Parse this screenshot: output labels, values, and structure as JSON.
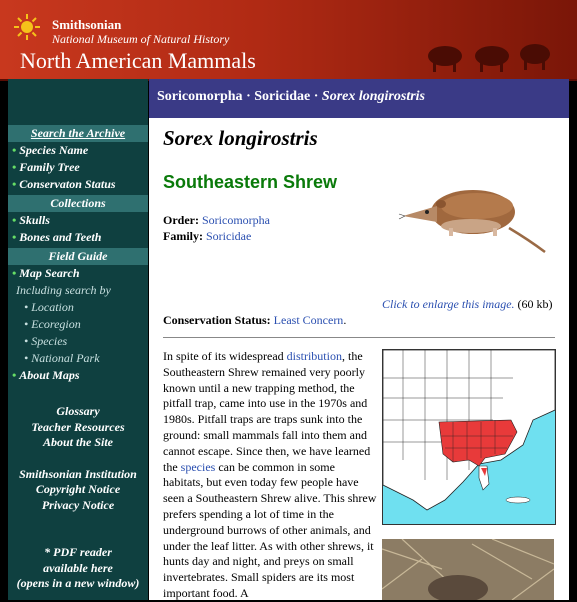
{
  "header": {
    "institution": "Smithsonian",
    "museum": "National Museum of Natural History",
    "site_title": "North American Mammals"
  },
  "sidebar": {
    "archive_heading": "Search the Archive",
    "archive_items": [
      "Species Name",
      "Family Tree",
      "Conservaton Status"
    ],
    "collections_heading": "Collections",
    "collections_items": [
      "Skulls",
      "Bones and Teeth"
    ],
    "field_guide_heading": "Field Guide",
    "map_search": "Map Search",
    "including": "Including search by",
    "search_by": [
      "Location",
      "Ecoregion",
      "Species",
      "National Park"
    ],
    "about_maps": "About Maps",
    "links1": [
      "Glossary",
      "Teacher Resources",
      "About the Site"
    ],
    "links2": [
      "Smithsonian Institution",
      "Copyright Notice",
      "Privacy Notice"
    ],
    "pdf_note": [
      "* PDF reader",
      "available here",
      "(opens in a new window)"
    ]
  },
  "breadcrumb": {
    "order": "Soricomorpha",
    "sep1": " · ",
    "family": "Soricidae",
    "sep2": " · ",
    "species": "Sorex longirostris"
  },
  "species": {
    "scientific_name": "Sorex longirostris",
    "common_name": "Southeastern Shrew",
    "order_label": "Order:",
    "order_value": "Soricomorpha",
    "family_label": "Family:",
    "family_value": "Soricidae",
    "enlarge_link": "Click to enlarge this image.",
    "enlarge_size": "(60 kb)",
    "status_label": "Conservation Status:",
    "status_value": "Least Concern",
    "status_end": "."
  },
  "description": {
    "p1": "In spite of its widespread ",
    "link1": "distribution",
    "p2": ", the Southeastern Shrew remained very poorly known until a new trapping method, the pitfall trap, came into use in the 1970s and 1980s. Pitfall traps are traps sunk into the ground: small mammals fall into them and cannot escape. Since then, we have learned the ",
    "link2": "species",
    "p3": " can be common in some habitats, but even today few people have seen a Southeastern Shrew alive. This shrew prefers spending a lot of time in the underground burrows of other animals, and under the leaf litter. As with other shrews, it hunts day and night, and preys on small invertebrates. Small spiders are its most important food. A"
  },
  "colors": {
    "header_red": "#b02a14",
    "sidebar_teal": "#0f4040",
    "sidebar_heading": "#2f7070",
    "crumb_blue": "#3a3a86",
    "common_name_green": "#0a7a0a",
    "link_blue": "#2a4fb0",
    "range_red": "#e83a3a",
    "map_water": "#6fe0f0"
  }
}
